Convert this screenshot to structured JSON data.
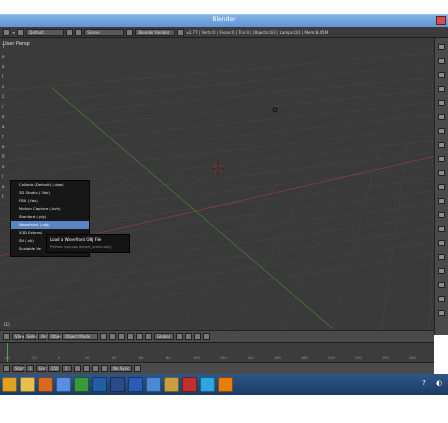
{
  "window": {
    "title": "Blender"
  },
  "infobar": {
    "layout": "Default",
    "scene": "Scene",
    "engine": "Blender Render",
    "stats": "v2.77 | Verts:0 | Faces:0 | Tris:0 | Objects:0/3 | Lamps:0/1 | Mem:8.45M"
  },
  "viewport": {
    "view_label": "User Persp",
    "object_label": "(1)",
    "left_labels": [
      "T",
      "o",
      "o",
      "l",
      "s",
      "C",
      "r",
      "e",
      "a",
      "t",
      "e",
      "R",
      "e",
      "l",
      "a",
      "t"
    ]
  },
  "import_menu": {
    "items": [
      "Collada (Default) (.dae)",
      "3D Studio (.3ds)",
      "FBX (.fbx)",
      "Motion Capture (.bvh)",
      "Stanford (.ply)",
      "Wavefront (.obj)",
      "X3D Extensi",
      "Stl (.stl)",
      "Scalable Ve"
    ],
    "selected_index": 5
  },
  "tooltip": {
    "title": "Load a Wavefront OBJ File",
    "python": "Python: bpy.ops.import_scene.obj()"
  },
  "view_header": {
    "mode": "Object Mode",
    "pivot": "Global",
    "view_menu": "View",
    "select_menu": "Select",
    "add_menu": "Add",
    "object_menu": "Object"
  },
  "timeline": {
    "ticks": [
      "-40",
      "-20",
      "0",
      "20",
      "40",
      "60",
      "80",
      "100",
      "120",
      "140",
      "160",
      "180",
      "200",
      "220",
      "240",
      "260"
    ],
    "start_label": "Start:",
    "start": "1",
    "end_label": "End:",
    "end": "250",
    "frame": "1",
    "sync": "No Sync"
  },
  "colors": {
    "viewport_bg": "#3a3a3a",
    "menu_bg": "#171717",
    "menu_highlight": "#5b84c2",
    "titlebar": "#6fa3dc",
    "taskbar": "#2e5787"
  },
  "taskbar": {
    "icons": [
      {
        "name": "start-button-icon",
        "color": "#e0a020"
      },
      {
        "name": "explorer-icon",
        "color": "#e8c050"
      },
      {
        "name": "firefox-icon",
        "color": "#d86a20"
      },
      {
        "name": "media-player-icon",
        "color": "#5a8ee0"
      },
      {
        "name": "chrome-icon",
        "color": "#3a9a3a"
      },
      {
        "name": "hp-icon",
        "color": "#1f5fa6"
      },
      {
        "name": "photoshop-icon",
        "color": "#2a4a8a"
      },
      {
        "name": "word-icon",
        "color": "#2b5bb5"
      },
      {
        "name": "outlook-icon",
        "color": "#4a8ad0"
      },
      {
        "name": "paint-icon",
        "color": "#c8a040"
      },
      {
        "name": "pdf-icon",
        "color": "#c03030"
      },
      {
        "name": "skype-icon",
        "color": "#2fa6e0"
      },
      {
        "name": "blender-icon",
        "color": "#e87d0d"
      }
    ]
  }
}
